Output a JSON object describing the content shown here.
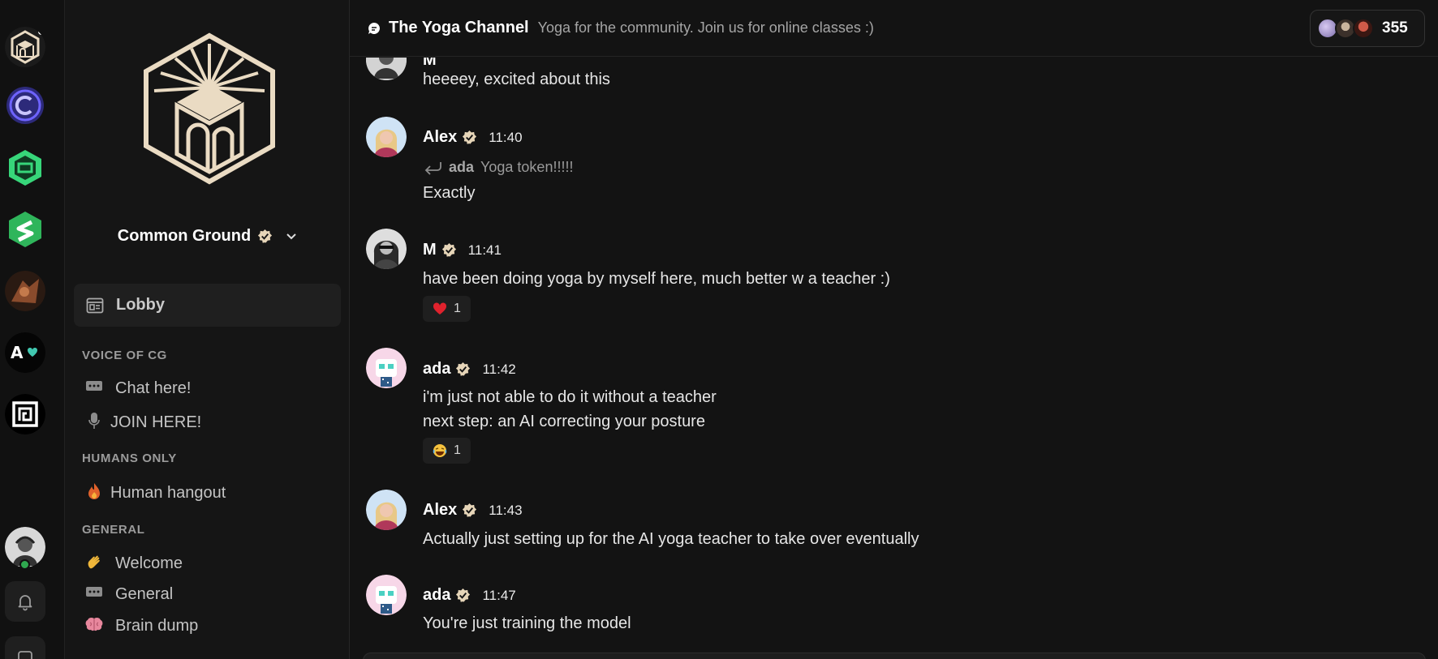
{
  "rail": {
    "servers": [
      {
        "name": "common-ground"
      },
      {
        "name": "purple-coin"
      },
      {
        "name": "green-cube"
      },
      {
        "name": "green-s"
      },
      {
        "name": "copper-figure"
      },
      {
        "name": "a-heart"
      },
      {
        "name": "maze-square"
      }
    ],
    "profile_icon": "user-avatar",
    "notifications_icon": "bell-icon",
    "wallet_icon": "wallet-icon"
  },
  "sidebar": {
    "community_name": "Common Ground",
    "lobby_label": "Lobby",
    "sections": [
      {
        "title": "VOICE OF CG",
        "channels": [
          {
            "icon": "chat-bubble-icon",
            "label": "Chat here!"
          },
          {
            "icon": "microphone-icon",
            "label": "JOIN HERE!"
          }
        ]
      },
      {
        "title": "HUMANS ONLY",
        "channels": [
          {
            "icon": "fire-icon",
            "label": "Human hangout"
          }
        ]
      },
      {
        "title": "GENERAL",
        "channels": [
          {
            "icon": "wave-icon",
            "label": "Welcome"
          },
          {
            "icon": "chat-bubble-icon",
            "label": "General"
          },
          {
            "icon": "brain-icon",
            "label": "Brain dump"
          }
        ]
      }
    ]
  },
  "header": {
    "channel_title": "The Yoga Channel",
    "channel_description": "Yoga for the community. Join us for online classes :)",
    "member_count": "355"
  },
  "messages": [
    {
      "partial_author": "M",
      "text": "heeeey, excited about this"
    },
    {
      "author": "Alex",
      "time": "11:40",
      "reply_to": "ada",
      "reply_text": "Yoga token!!!!!",
      "text": "Exactly"
    },
    {
      "author": "M",
      "time": "11:41",
      "text": "have been doing yoga by myself here, much better w a teacher :)",
      "reaction_emoji": "❤️",
      "reaction_count": "1"
    },
    {
      "author": "ada",
      "time": "11:42",
      "text": "i'm just not able to do it without a teacher",
      "text2": "next step: an AI correcting your posture",
      "reaction_emoji": "😂",
      "reaction_count": "1"
    },
    {
      "author": "Alex",
      "time": "11:43",
      "text": "Actually just setting up for the AI yoga teacher to take over eventually"
    },
    {
      "author": "ada",
      "time": "11:47",
      "text": "You're just training the model"
    }
  ],
  "colors": {
    "background": "#131313",
    "sidebar": "#151515",
    "accent_logo": "#eadbc3",
    "verified_badge": "#e6d5b8",
    "online": "#2fa84f"
  }
}
